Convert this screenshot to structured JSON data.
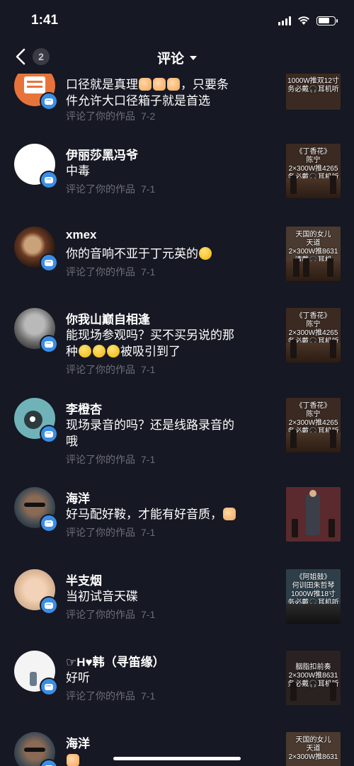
{
  "status_bar": {
    "time": "1:41"
  },
  "nav": {
    "title": "评论",
    "count": "2"
  },
  "comments": [
    {
      "name": "",
      "text": "口径就是真理👍👍👍，只要条件允许大口径箱子就是首选",
      "text_parts": [
        "口径就是真理",
        "，只要条",
        "件允许大口径箱子就是首选"
      ],
      "action": "评论了你的作品",
      "date": "7-2",
      "thumb_text": "1000W推双12寸\n务必戴🎧耳机听"
    },
    {
      "name": "伊丽莎黑冯爷",
      "text": "中毒",
      "action": "评论了你的作品",
      "date": "7-1",
      "thumb_text": "《丁香花》\n陈宁\n2×300W推4265\n务必戴🎧耳机听"
    },
    {
      "name": "xmex",
      "text": "你的音响不亚于丁元英的🤣",
      "text_plain": "你的音响不亚于丁元英的",
      "action": "评论了你的作品",
      "date": "7-1",
      "thumb_text": "天国的女儿\n天道\n2×300W推8631\n请戴🎧耳机"
    },
    {
      "name": "你我山巅自相逢",
      "text_line1": "能现场参观吗？买不买另说的那",
      "text_line2": "种",
      "text_line2_tail": "被吸引到了",
      "action": "评论了你的作品",
      "date": "7-1",
      "thumb_text": "《丁香花》\n陈宁\n2×300W推4265\n务必戴🎧耳机听"
    },
    {
      "name": "李橙杏",
      "text_line1": "现场录音的吗？还是线路录音的",
      "text_line2": "哦",
      "action": "评论了你的作品",
      "date": "7-1",
      "thumb_text": "《丁香花》\n陈宁\n2×300W推4265\n务必戴🎧耳机听"
    },
    {
      "name": "海洋",
      "text": "好马配好鞍，才能有好音质，",
      "action": "评论了你的作品",
      "date": "7-1",
      "thumb_text": ""
    },
    {
      "name": "半支烟",
      "text": "当初试音天碟",
      "action": "评论了你的作品",
      "date": "7-1",
      "thumb_text": "《阿姐鼓》\n何训田朱哲琴\n1000W推18寸\n务必戴🎧耳机听"
    },
    {
      "name": "☞H♥韩（寻笛缘）",
      "text": "好听",
      "action": "评论了你的作品",
      "date": "7-1",
      "thumb_text": "胭脂扣前奏\n2×300W推8631\n务必戴🎧耳机听"
    },
    {
      "name": "海洋",
      "text": "",
      "action": "",
      "date": "",
      "thumb_text": "天国的女儿\n天道\n2×300W推8631"
    }
  ]
}
